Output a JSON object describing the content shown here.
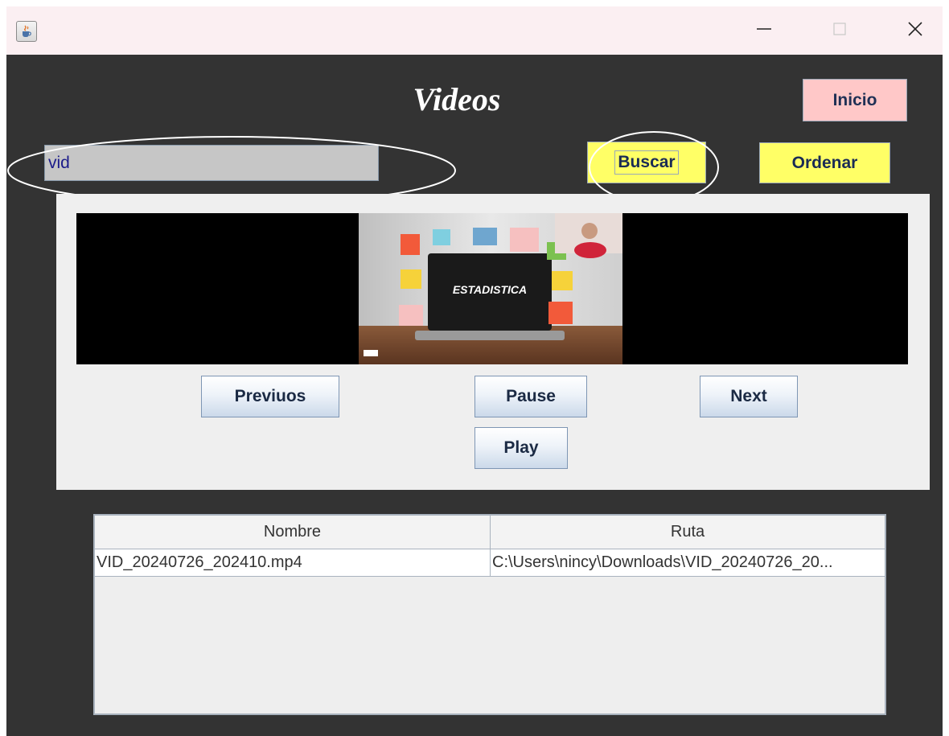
{
  "window": {
    "icon": "java-cup-icon",
    "controls": {
      "minimize": "minimize-icon",
      "maximize": "maximize-icon",
      "close": "close-icon"
    }
  },
  "header": {
    "title": "Videos"
  },
  "buttons": {
    "inicio": "Inicio",
    "buscar": "Buscar",
    "ordenar": "Ordenar"
  },
  "search": {
    "value": "vid"
  },
  "player": {
    "thumbnail_title": "ESTADISTICA",
    "controls": {
      "previous": "Previuos",
      "pause": "Pause",
      "next": "Next",
      "play": "Play"
    }
  },
  "table": {
    "columns": [
      "Nombre",
      "Ruta"
    ],
    "rows": [
      [
        "VID_20240726_202410.mp4",
        "C:\\Users\\nincy\\Downloads\\VID_20240726_20..."
      ]
    ]
  },
  "colors": {
    "background": "#333333",
    "inicio_button": "#ffc8c8",
    "yellow_buttons": "#ffff66",
    "search_field": "#c6c6c6"
  }
}
